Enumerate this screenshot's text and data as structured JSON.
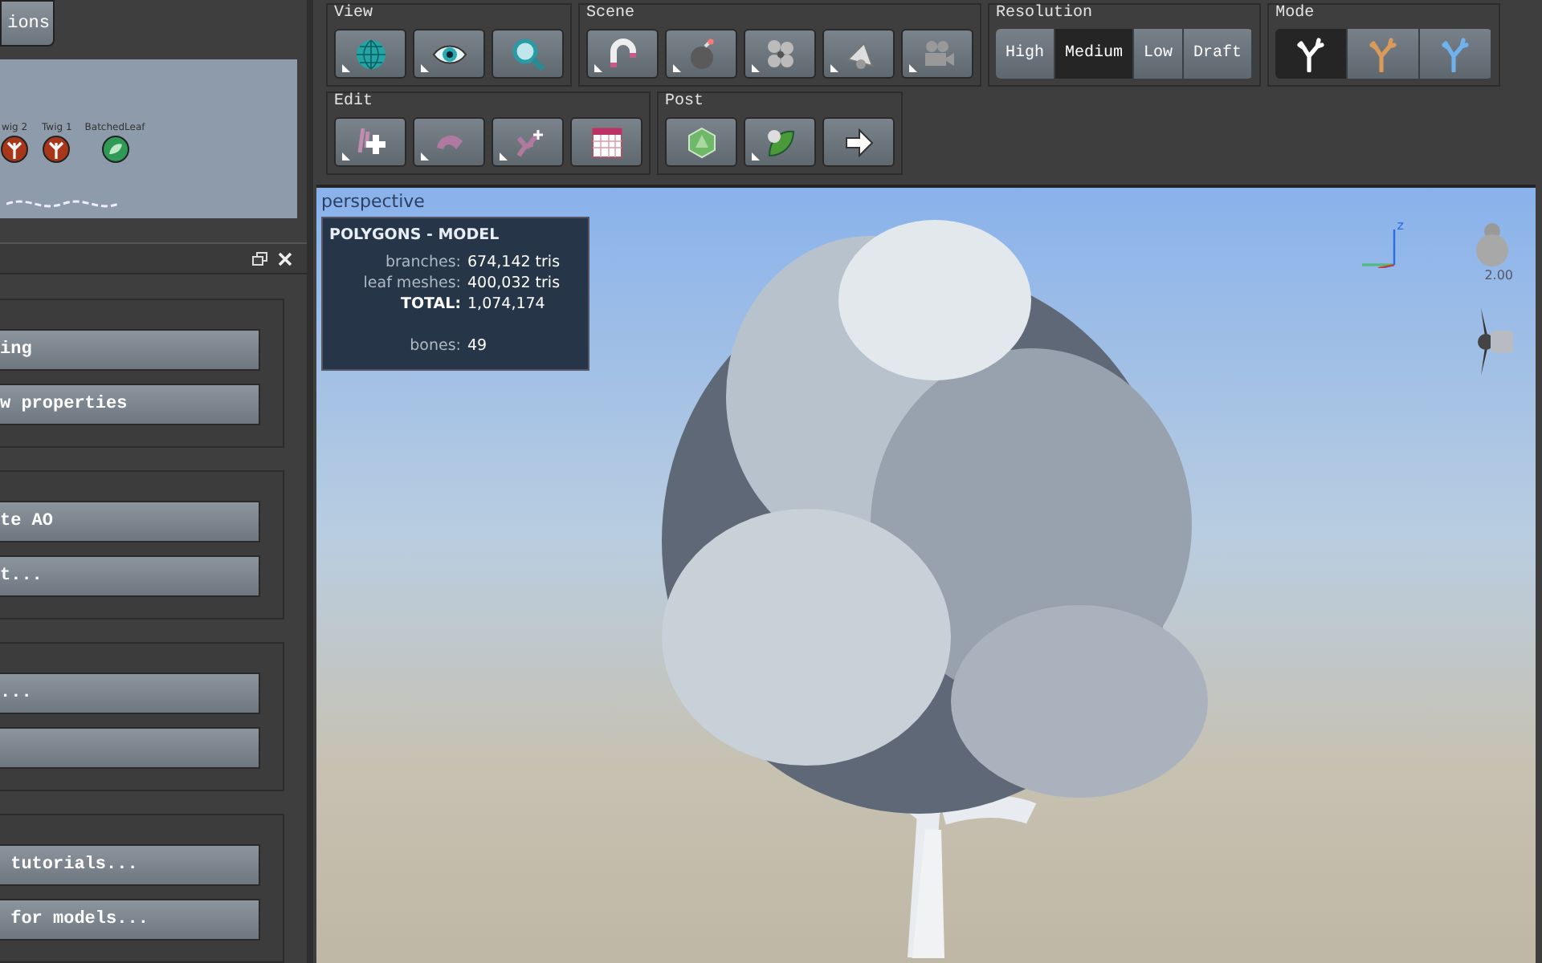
{
  "left_panel": {
    "top_button": "ions",
    "node_graph": {
      "nodes": [
        {
          "label": "wig 2",
          "kind": "twig"
        },
        {
          "label": "Twig 1",
          "kind": "twig"
        },
        {
          "label": "BatchedLeaf",
          "kind": "leaf"
        }
      ]
    },
    "groups": [
      {
        "buttons": [
          {
            "label": "ing"
          },
          {
            "label": "w properties"
          }
        ]
      },
      {
        "buttons": [
          {
            "label": "te AO"
          },
          {
            "label": "t..."
          }
        ]
      },
      {
        "buttons": [
          {
            "label": "..."
          }
        ]
      },
      {
        "buttons": [
          {
            "label": " tutorials..."
          },
          {
            "label": " for models..."
          }
        ]
      }
    ]
  },
  "toolbar_rows": [
    [
      {
        "title": "View",
        "kind": "icons",
        "buttons": [
          {
            "menu": true
          },
          {
            "menu": true
          },
          {
            "menu": false
          }
        ]
      },
      {
        "title": "Scene",
        "kind": "icons",
        "buttons": [
          {
            "menu": true
          },
          {
            "menu": true
          },
          {
            "menu": true
          },
          {
            "menu": true
          },
          {
            "menu": true
          }
        ]
      },
      {
        "title": "Resolution",
        "kind": "segments",
        "options": [
          {
            "label": "High",
            "selected": false
          },
          {
            "label": "Medium",
            "selected": true
          },
          {
            "label": "Low",
            "selected": false
          },
          {
            "label": "Draft",
            "selected": false
          }
        ]
      },
      {
        "title": "Mode",
        "kind": "modes",
        "options": [
          {
            "color": "#ffffff",
            "selected": true
          },
          {
            "color": "#d99a5a",
            "selected": false
          },
          {
            "color": "#6fb2ee",
            "selected": false
          }
        ]
      }
    ],
    [
      {
        "title": "Edit",
        "kind": "icons",
        "buttons": [
          {
            "menu": true
          },
          {
            "menu": true
          },
          {
            "menu": true
          },
          {
            "menu": false
          }
        ]
      },
      {
        "title": "Post",
        "kind": "icons",
        "buttons": [
          {
            "menu": false
          },
          {
            "menu": true
          },
          {
            "menu": false
          }
        ]
      }
    ]
  ],
  "viewport": {
    "label": "perspective",
    "stats": {
      "title": "POLYGONS - MODEL",
      "rows": [
        {
          "label": "branches:",
          "value": "674,142 tris",
          "bold": false
        },
        {
          "label": "leaf meshes:",
          "value": "400,032 tris",
          "bold": false
        },
        {
          "label": "TOTAL:",
          "value": "1,074,174",
          "bold": true
        },
        {
          "label": "bones:",
          "value": "49",
          "bold": false
        }
      ]
    },
    "axis_label": "z",
    "light_value": "2.00"
  }
}
